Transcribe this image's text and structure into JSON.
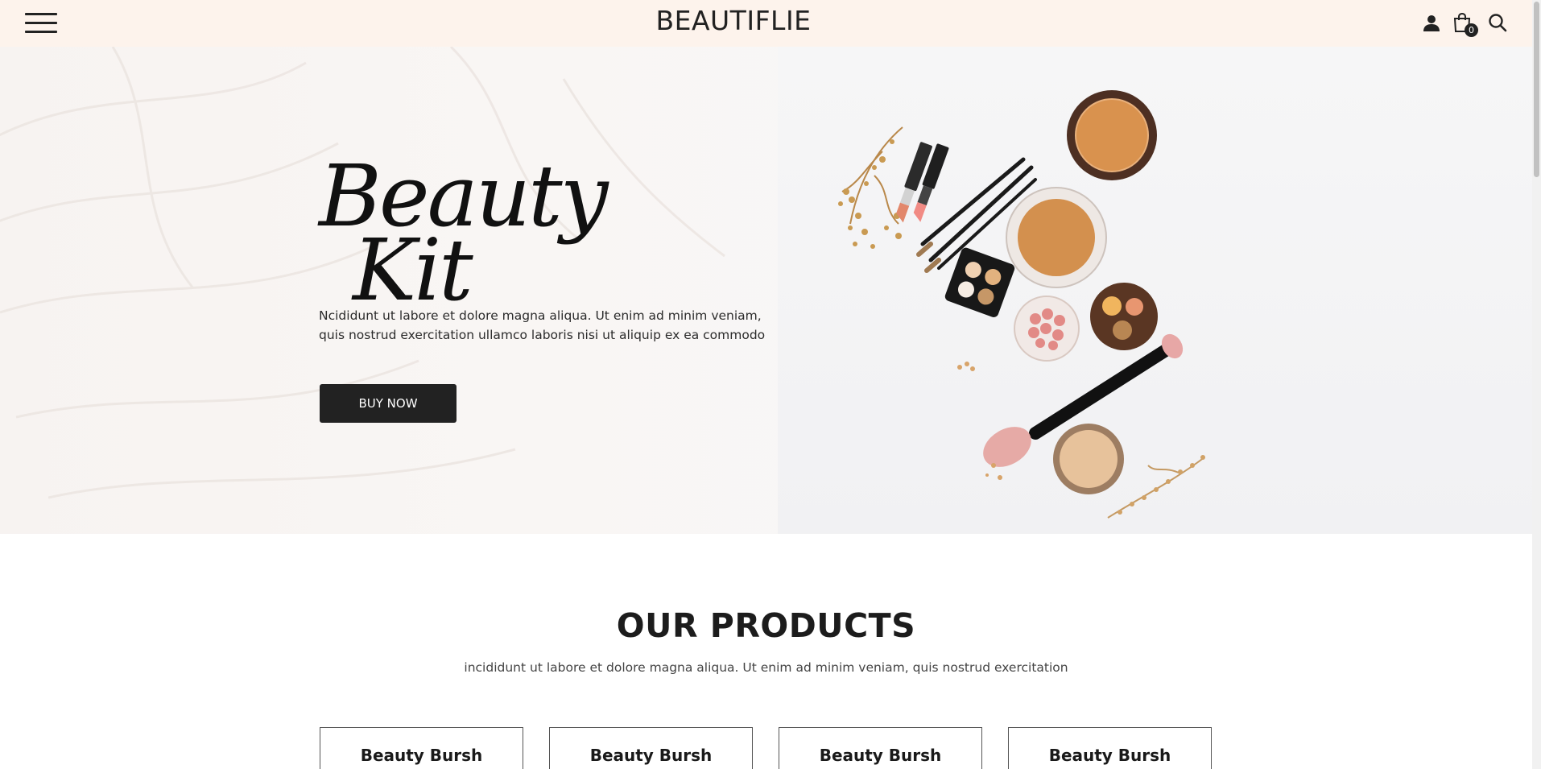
{
  "header": {
    "brand": "BEAUTIFLIE",
    "menu_icon": "hamburger-menu-icon",
    "user_icon": "user-icon",
    "cart_icon": "shopping-bag-icon",
    "cart_count": "0",
    "search_icon": "search-icon",
    "background_color": "#fdf3ec"
  },
  "hero": {
    "title_line1": "Beauty",
    "title_line2": "Kit",
    "description_line1": "Ncididunt ut labore et dolore magna aliqua. Ut enim ad minim veniam,",
    "description_line2": "quis nostrud exercitation ullamco laboris nisi ut aliquip ex ea commodo",
    "button_label": "BUY NOW"
  },
  "products": {
    "heading": "OUR PRODUCTS",
    "subheading": "incididunt ut labore et dolore magna aliqua. Ut enim ad minim veniam, quis nostrud exercitation",
    "items": [
      {
        "name": "Beauty Bursh"
      },
      {
        "name": "Beauty Bursh"
      },
      {
        "name": "Beauty Bursh"
      },
      {
        "name": "Beauty Bursh"
      }
    ]
  },
  "colors": {
    "primary_dark": "#222222",
    "accent_peach": "#fdf3ec"
  }
}
